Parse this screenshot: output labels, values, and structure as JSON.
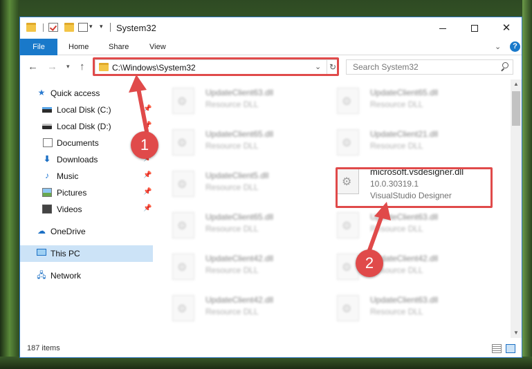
{
  "window": {
    "title": "System32",
    "controls": {
      "minimize": "",
      "maximize": "",
      "close": "✕"
    }
  },
  "ribbon": {
    "tabs": [
      "File",
      "Home",
      "Share",
      "View"
    ],
    "help": "?"
  },
  "navigation": {
    "address": "C:\\Windows\\System32",
    "search_placeholder": "Search System32"
  },
  "sidebar": {
    "items": [
      {
        "label": "Quick access",
        "icon": "star-icon",
        "pinned": false
      },
      {
        "label": "Local Disk (C:)",
        "icon": "drive-icon",
        "pinned": true
      },
      {
        "label": "Local Disk (D:)",
        "icon": "drive-icon",
        "pinned": true
      },
      {
        "label": "Documents",
        "icon": "documents-icon",
        "pinned": true
      },
      {
        "label": "Downloads",
        "icon": "download-icon",
        "pinned": true
      },
      {
        "label": "Music",
        "icon": "music-icon",
        "pinned": true
      },
      {
        "label": "Pictures",
        "icon": "pictures-icon",
        "pinned": true
      },
      {
        "label": "Videos",
        "icon": "video-icon",
        "pinned": true
      },
      {
        "label": "OneDrive",
        "icon": "cloud-icon",
        "pinned": false
      },
      {
        "label": "This PC",
        "icon": "computer-icon",
        "pinned": false,
        "selected": true
      },
      {
        "label": "Network",
        "icon": "network-icon",
        "pinned": false
      }
    ]
  },
  "files": [
    {
      "name": "UpdateClient63.dll",
      "desc": "Resource DLL"
    },
    {
      "name": "UpdateClient65.dll",
      "desc": "Resource DLL"
    },
    {
      "name": "UpdateClient65.dll",
      "desc": "Resource DLL"
    },
    {
      "name": "UpdateClient21.dll",
      "desc": "Resource DLL"
    },
    {
      "name": "UpdateClient5.dll",
      "desc": "Resource DLL"
    },
    {
      "name": "microsoft.vsdesigner.dll",
      "desc": "10.0.30319.1",
      "desc2": "VisualStudio Designer",
      "highlighted": true
    },
    {
      "name": "UpdateClient65.dll",
      "desc": "Resource DLL"
    },
    {
      "name": "UpdateClient63.dll",
      "desc": "Resource DLL"
    },
    {
      "name": "UpdateClient42.dll",
      "desc": "Resource DLL"
    },
    {
      "name": "UpdateClient42.dll",
      "desc": "Resource DLL"
    },
    {
      "name": "UpdateClient42.dll",
      "desc": "Resource DLL"
    },
    {
      "name": "UpdateClient63.dll",
      "desc": "Resource DLL"
    }
  ],
  "status": {
    "item_count": "187 items"
  },
  "annotations": {
    "step1": "1",
    "step2": "2"
  },
  "colors": {
    "accent": "#1979ca",
    "highlight": "#e04a4a",
    "selected": "#cce3f7"
  }
}
